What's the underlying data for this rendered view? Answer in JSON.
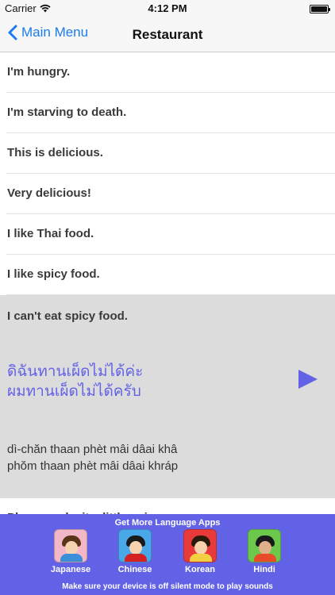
{
  "status_bar": {
    "carrier": "Carrier",
    "time": "4:12 PM"
  },
  "nav": {
    "back_label": "Main Menu",
    "title": "Restaurant"
  },
  "phrases": [
    "I'm hungry.",
    "I'm starving to death.",
    "This is delicious.",
    "Very delicious!",
    "I like Thai food.",
    "I like spicy food."
  ],
  "expanded": {
    "english": "I can't eat spicy food.",
    "thai_line1": "ดิฉันทานเผ็ดไม่ได้ค่ะ",
    "thai_line2": "ผมทานเผ็ดไม่ได้ครับ",
    "roman_line1": "dì-chăn thaan phèt mâi dâai khâ",
    "roman_line2": "phŏm thaan phèt mâi dâai khráp"
  },
  "next_partial": "Please make it a little spicy.",
  "banner": {
    "title": "Get More Language Apps",
    "apps": [
      "Japanese",
      "Chinese",
      "Korean",
      "Hindi"
    ],
    "footer": "Make sure your device is off silent mode to play sounds"
  },
  "colors": {
    "accent": "#1a7cf0",
    "thai_text": "#6262e6",
    "banner_bg": "#6262e6",
    "expanded_bg": "#dcdcdc"
  },
  "icons": {
    "back": "chevron-left-icon",
    "play": "play-icon",
    "wifi": "wifi-icon",
    "battery": "battery-icon"
  }
}
